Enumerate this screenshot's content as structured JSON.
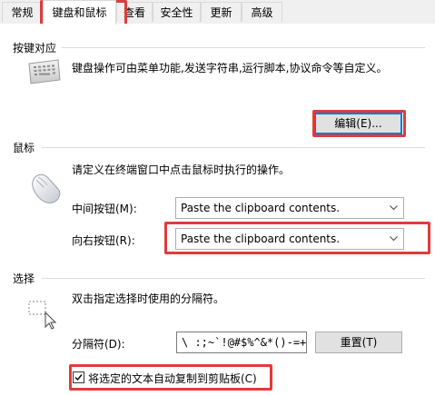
{
  "tabs": [
    {
      "label": "常规"
    },
    {
      "label": "键盘和鼠标",
      "active": true
    },
    {
      "label": "查看"
    },
    {
      "label": "安全性"
    },
    {
      "label": "更新"
    },
    {
      "label": "高级"
    }
  ],
  "keybinding": {
    "title": "按键对应",
    "description": "键盘操作可由菜单功能,发送字符串,运行脚本,协议命令等自定义。",
    "edit_button": "编辑(E)..."
  },
  "mouse": {
    "title": "鼠标",
    "description": "请定义在终端窗口中点击鼠标时执行的操作。",
    "middle_label": "中间按钮(M):",
    "middle_value": "Paste the clipboard contents.",
    "right_label": "向右按钮(R):",
    "right_value": "Paste the clipboard contents."
  },
  "selection": {
    "title": "选择",
    "description": "双击指定选择时使用的分隔符。",
    "delimiter_label": "分隔符(D):",
    "delimiter_value": "\\ :;~`!@#$%^&*()-=+|[]{}",
    "reset_button": "重置(T)",
    "auto_copy_label": "将选定的文本自动复制到剪贴板(C)",
    "auto_copy_checked": true
  },
  "colors": {
    "highlight": "#e03b3b",
    "focus": "#0078d7"
  }
}
